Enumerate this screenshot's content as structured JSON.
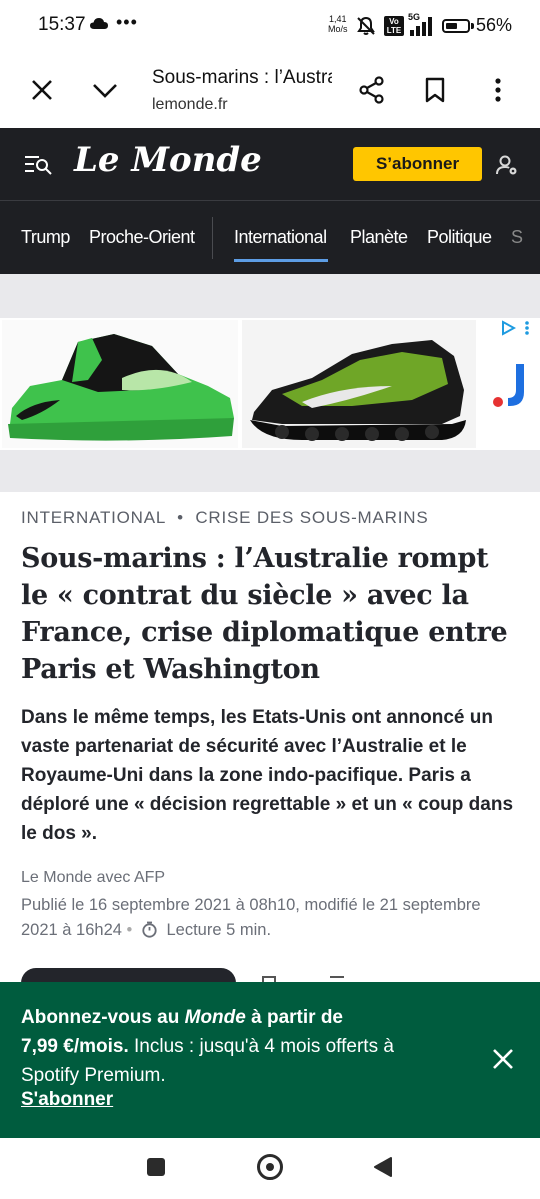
{
  "status_bar": {
    "time": "15:37",
    "more": "•••",
    "speed_value": "1,41",
    "speed_unit": "Mo/s",
    "volte": "Vo LTE",
    "network": "5G",
    "battery_level": 0.56,
    "battery_pct": "56%"
  },
  "browser": {
    "page_title": "Sous-marins : l’Australie rompt le « contrat du siècle » avec la France",
    "url": "lemonde.fr"
  },
  "header": {
    "logo": "Le Monde",
    "subscribe_label": "S’abonner"
  },
  "nav": {
    "items": [
      "Trump",
      "Proche-Orient",
      "International",
      "Planète",
      "Politique",
      "S"
    ],
    "active": "International"
  },
  "ad": {
    "colors": {
      "shoe_green": "#3fc24c",
      "shoe_black": "#151515",
      "logo_blue": "#1e6fe0",
      "logo_red": "#e63232"
    }
  },
  "article": {
    "kicker_section": "INTERNATIONAL",
    "kicker_sep": "•",
    "kicker_topic": "CRISE DES SOUS-MARINS",
    "headline": "Sous-marins : l’Australie rompt le « contrat du siècle » avec la France, crise diplomatique entre Paris et Washington",
    "standfirst": "Dans le même temps, les Etats-Unis ont annoncé un vaste partenariat de sécurité avec l’Australie et le Royaume-Uni dans la zone indo-pacifique. Paris a déploré une « décision regrettable » et un « coup dans le dos ».",
    "byline": "Le Monde avec AFP",
    "published": "Publié le 16 septembre 2021 à 08h10, modifié le 21 septembre 2021 à 16h24",
    "meta_sep": "•",
    "reading_time": "Lecture 5 min."
  },
  "promo": {
    "line_prefix": "Abonnez-vous au ",
    "line_brand": "Monde",
    "line_suffix": " à partir de",
    "price": "7,99 €/mois.",
    "offer": " Inclus : jusqu'à 4 mois offerts à Spotify Premium.",
    "cta": "S'abonner",
    "bg_color": "#005c3e"
  }
}
